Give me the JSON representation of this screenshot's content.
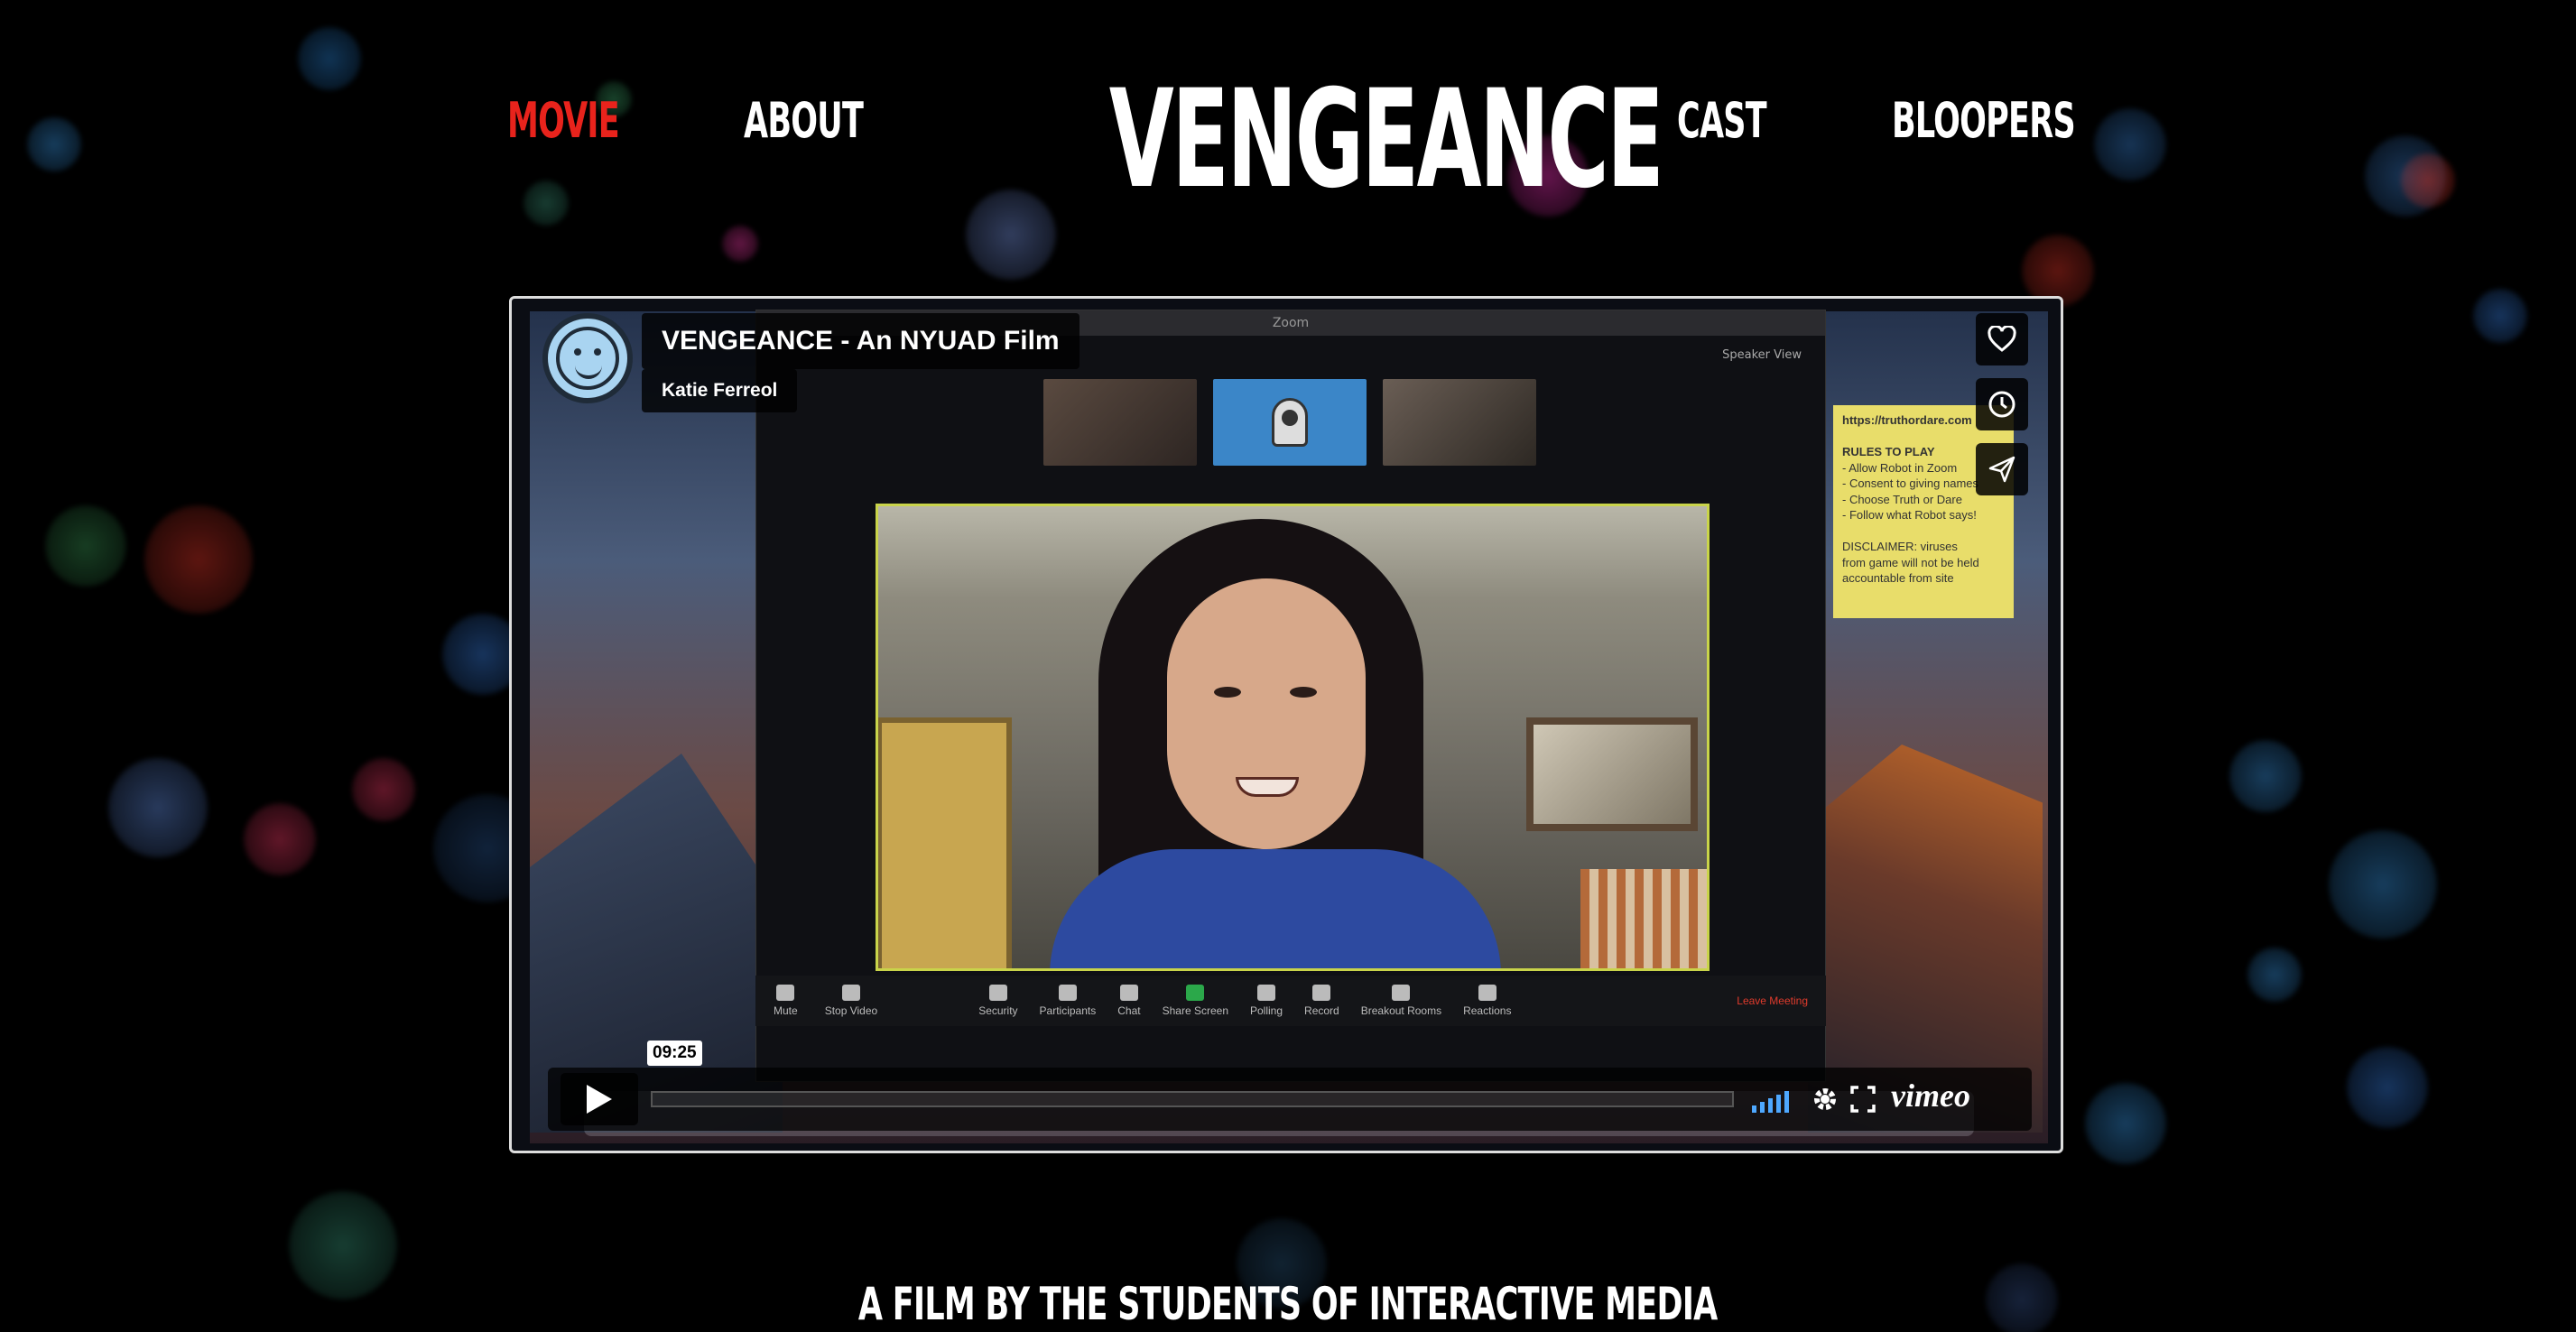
{
  "nav": {
    "left": [
      {
        "label": "MOVIE",
        "active": true
      },
      {
        "label": "ABOUT",
        "active": false
      }
    ],
    "logo": "VENGEANCE",
    "right": [
      {
        "label": "CAST",
        "active": false
      },
      {
        "label": "BLOOPERS",
        "active": false
      }
    ],
    "active_color": "#e8231c"
  },
  "video": {
    "title": "VENGEANCE - An NYUAD Film",
    "byline": "Katie Ferreol",
    "side_buttons": [
      {
        "icon": "heart-icon"
      },
      {
        "icon": "clock-icon"
      },
      {
        "icon": "send-icon"
      }
    ],
    "controls": {
      "time": "09:25",
      "progress": 0.0,
      "brand": "vimeo",
      "accent": "#4ea8ff"
    },
    "zoom_frame": {
      "window_title": "Zoom",
      "speaker_view": "Speaker View",
      "notes": [
        "https://truthordare.com",
        "",
        "RULES TO PLAY",
        "- Allow Robot in Zoom",
        "- Consent to giving names",
        "- Choose Truth or Dare",
        "- Follow what Robot says!",
        "",
        "DISCLAIMER: viruses",
        "from game will not be held",
        "accountable from site"
      ],
      "toolbar": [
        {
          "label": "Mute"
        },
        {
          "label": "Stop Video"
        },
        {
          "label": "Security"
        },
        {
          "label": "Participants"
        },
        {
          "label": "Chat"
        },
        {
          "label": "Share Screen",
          "accent": true
        },
        {
          "label": "Polling"
        },
        {
          "label": "Record"
        },
        {
          "label": "Breakout Rooms"
        },
        {
          "label": "Reactions"
        }
      ],
      "leave": "Leave Meeting"
    }
  },
  "tagline": "A FILM BY THE STUDENTS OF INTERACTIVE MEDIA"
}
